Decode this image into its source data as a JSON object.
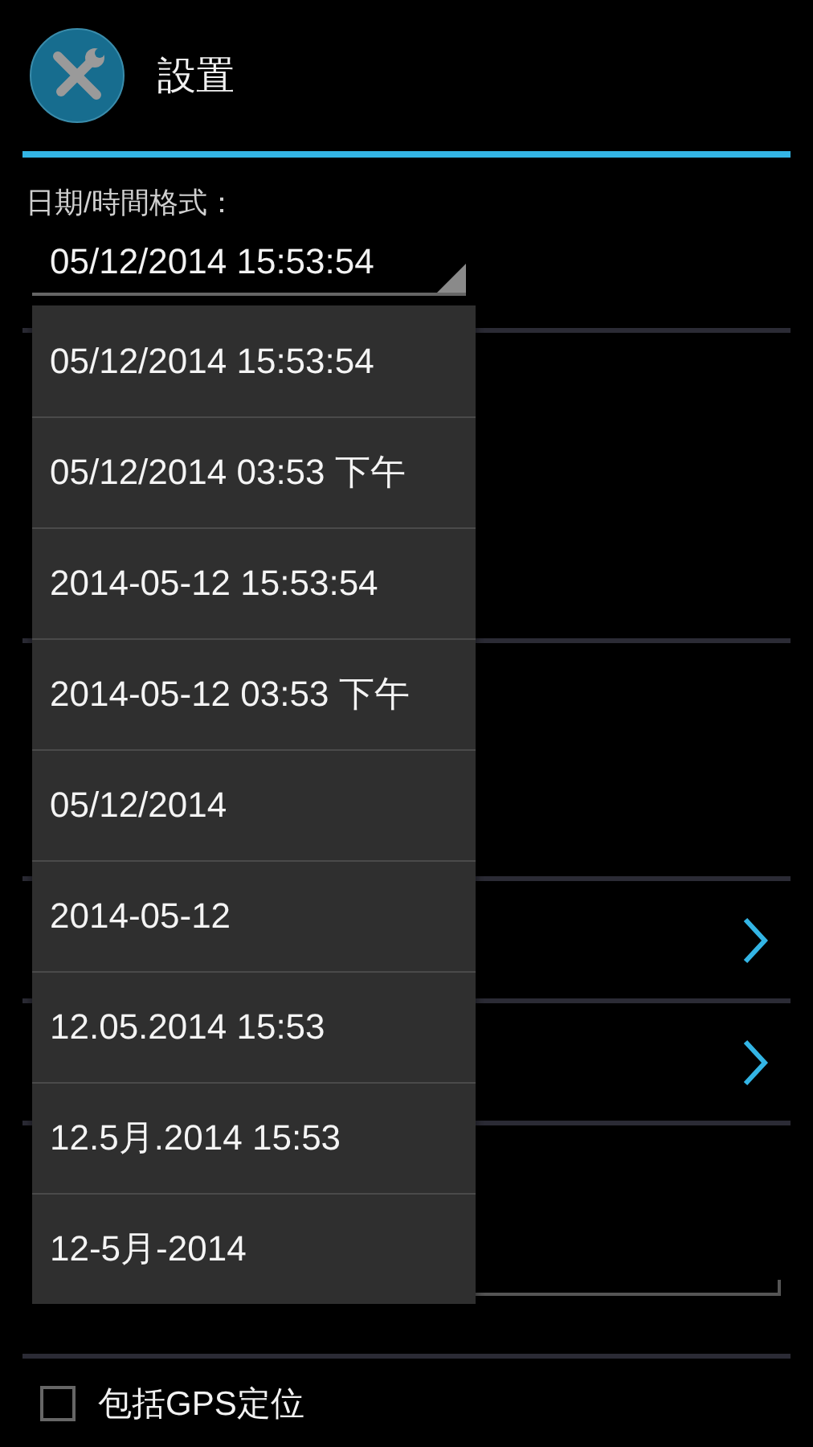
{
  "header": {
    "title": "設置"
  },
  "date_format": {
    "label": "日期/時間格式：",
    "value": "05/12/2014 15:53:54"
  },
  "dropdown": {
    "options": [
      "05/12/2014 15:53:54",
      "05/12/2014 03:53 下午",
      "2014-05-12 15:53:54",
      "2014-05-12 03:53 下午",
      "05/12/2014",
      "2014-05-12",
      "12.05.2014 15:53",
      "12.5月.2014 15:53",
      "12-5月-2014"
    ]
  },
  "gps_checkbox": {
    "label": "包括GPS定位",
    "checked": false
  }
}
